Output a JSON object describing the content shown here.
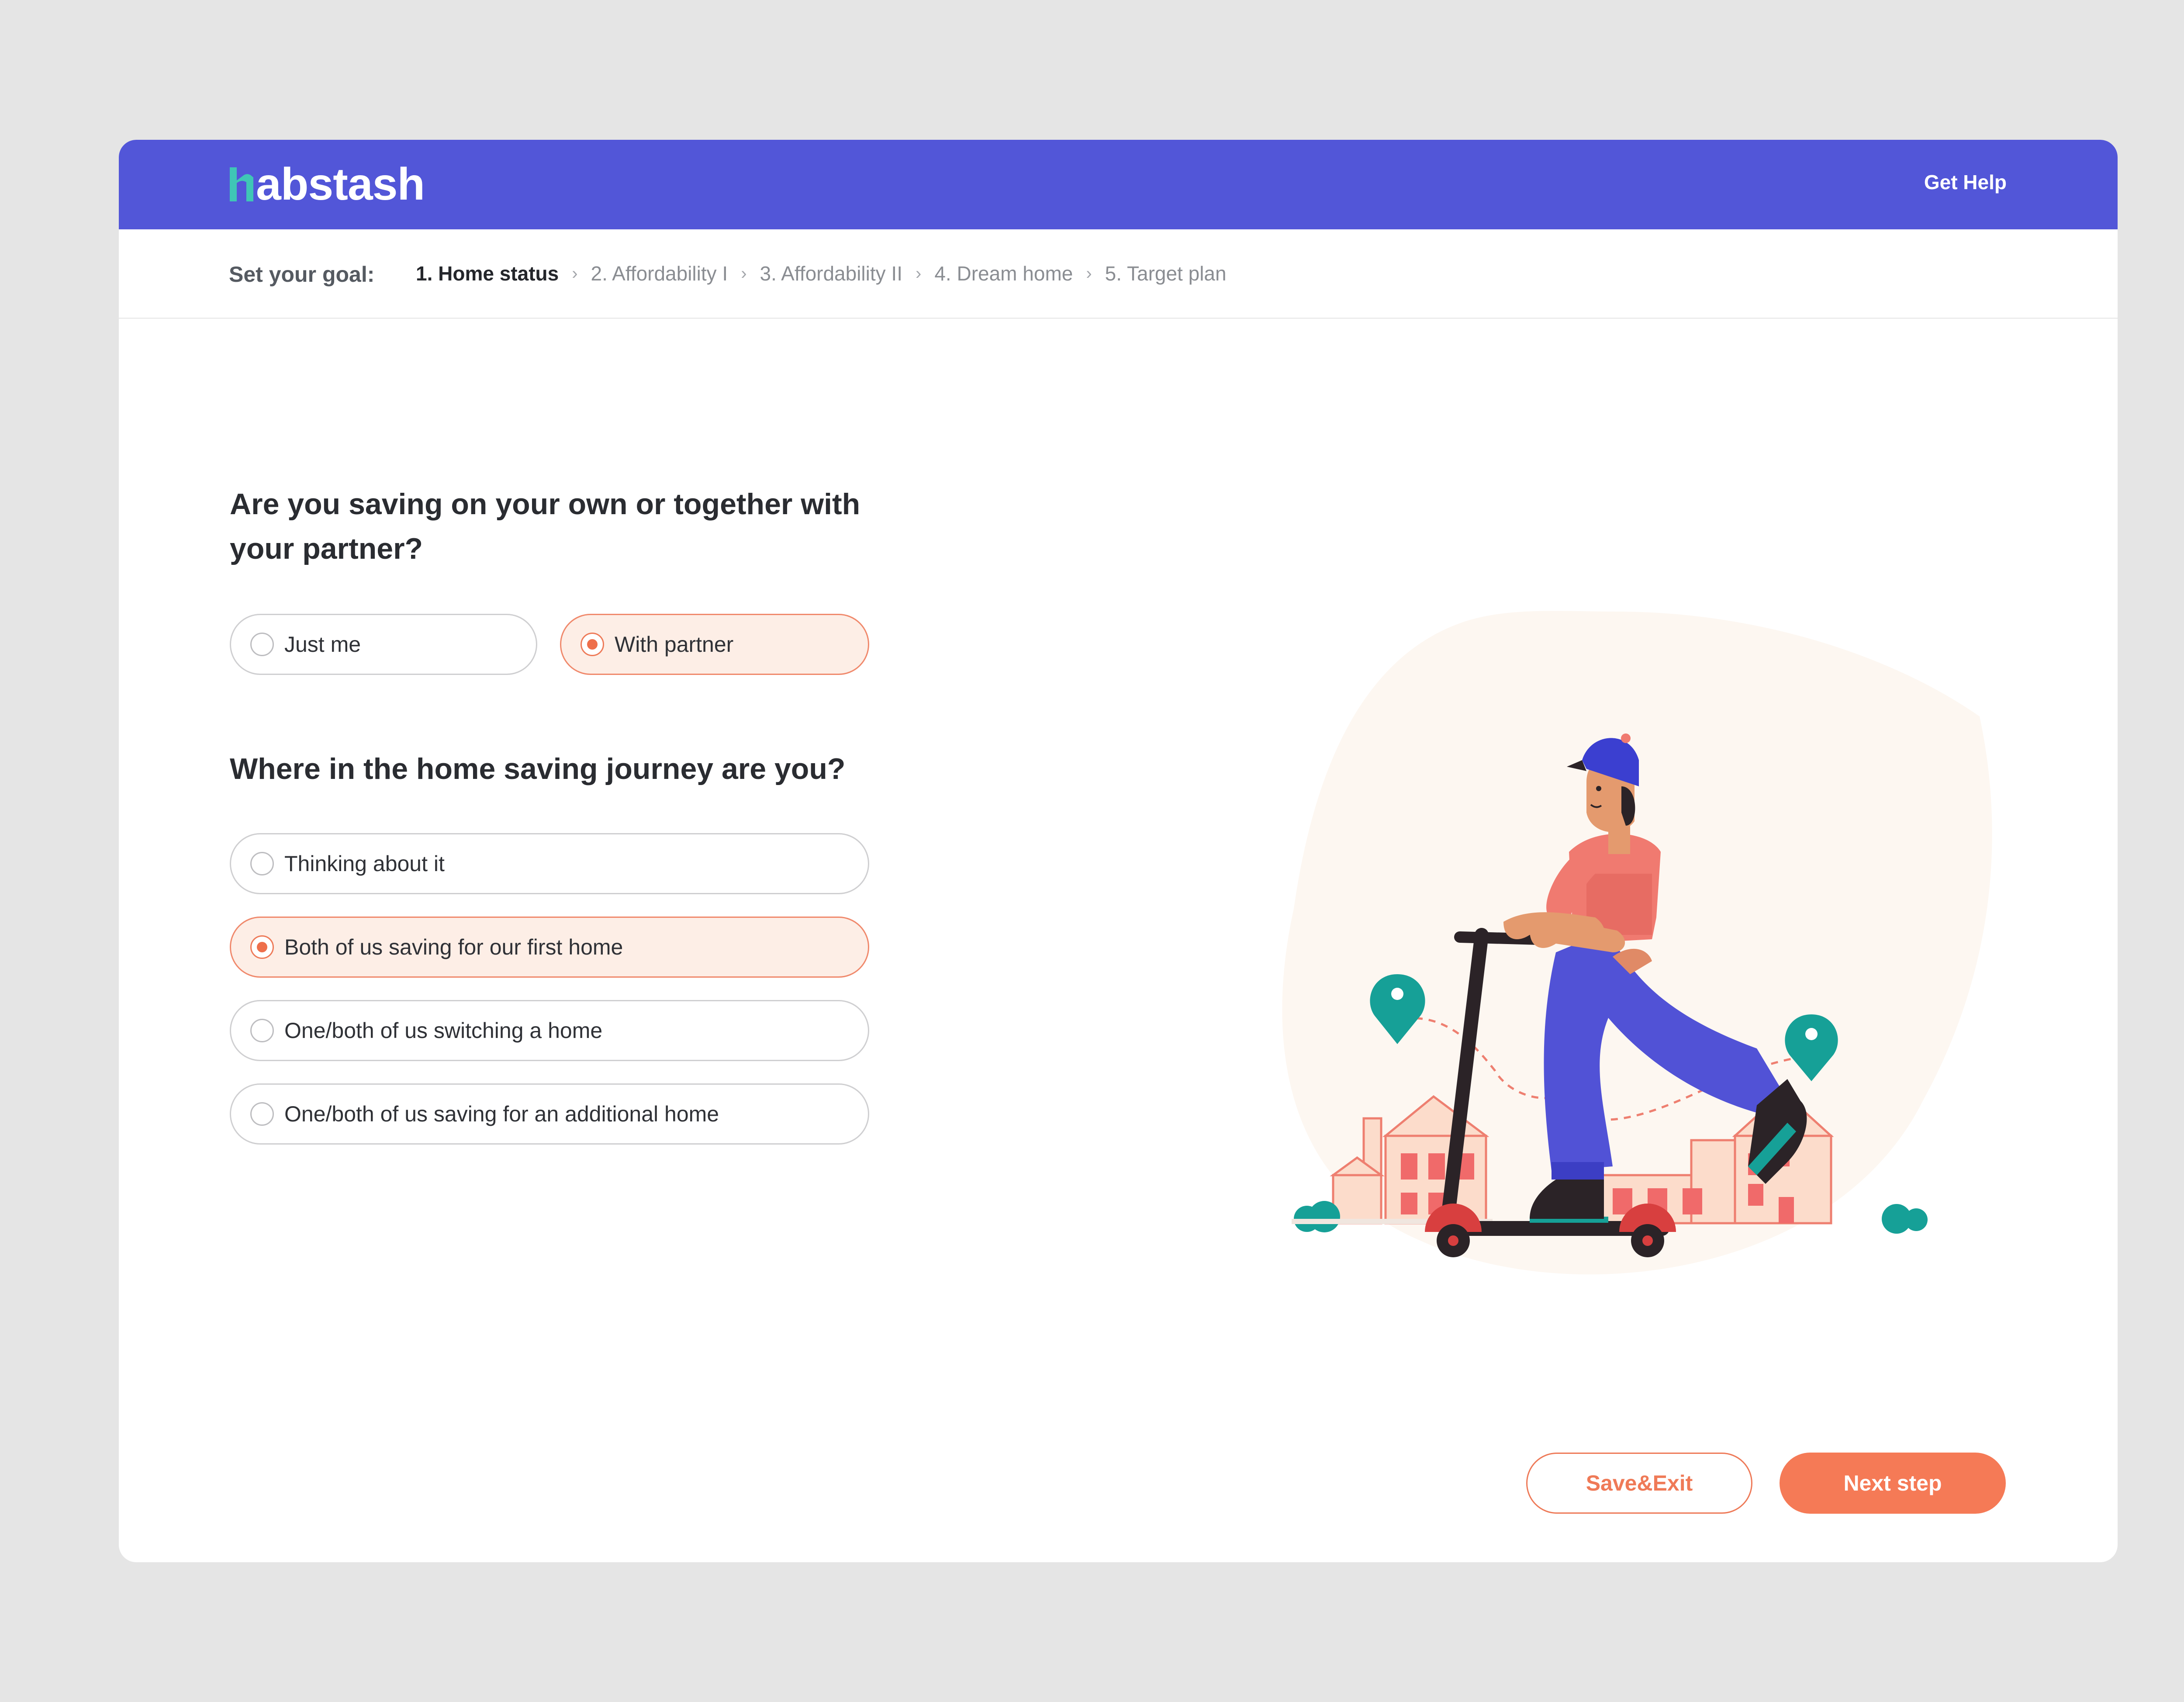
{
  "brand": {
    "logo_text": "abstash",
    "logo_full": "habstash",
    "color_header": "#5256d8",
    "color_accent": "#f57a56",
    "color_logo_icon": "#3fc6b6"
  },
  "header": {
    "help_label": "Get Help"
  },
  "stepbar": {
    "label": "Set your goal:",
    "steps": [
      {
        "label": "1. Home status",
        "active": true
      },
      {
        "label": "2. Affordability I",
        "active": false
      },
      {
        "label": "3. Affordability II",
        "active": false
      },
      {
        "label": "4. Dream home",
        "active": false
      },
      {
        "label": "5. Target plan",
        "active": false
      }
    ],
    "separator_icon": "chevron-right-icon"
  },
  "question1": {
    "title": "Are you saving on your own or together with your partner?",
    "options": [
      {
        "label": "Just me",
        "selected": false
      },
      {
        "label": "With partner",
        "selected": true
      }
    ]
  },
  "question2": {
    "title": "Where in the home saving journey are you?",
    "options": [
      {
        "label": "Thinking about it",
        "selected": false
      },
      {
        "label": "Both of us saving for our first home",
        "selected": true
      },
      {
        "label": "One/both of us switching a home",
        "selected": false
      },
      {
        "label": "One/both of us saving for an additional home",
        "selected": false
      }
    ]
  },
  "actions": {
    "save_exit_label": "Save&Exit",
    "next_label": "Next step"
  }
}
